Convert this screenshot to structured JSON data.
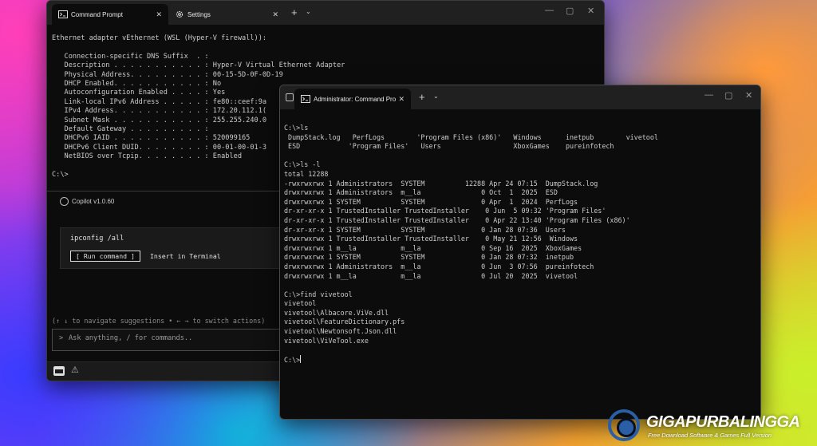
{
  "window1": {
    "tabs": [
      {
        "label": "Command Prompt",
        "icon": "terminal-icon",
        "active": true
      },
      {
        "label": "Settings",
        "icon": "gear-icon",
        "active": false
      }
    ],
    "new_tab": "+",
    "dropdown": "⌄",
    "controls": {
      "minimize": "—",
      "maximize": "▢",
      "close": "✕"
    },
    "lines": [
      "Ethernet adapter vEthernet (WSL (Hyper-V firewall)):",
      "",
      "   Connection-specific DNS Suffix  . :",
      "   Description . . . . . . . . . . . : Hyper-V Virtual Ethernet Adapter",
      "   Physical Address. . . . . . . . . : 00-15-5D-0F-0D-19",
      "   DHCP Enabled. . . . . . . . . . . : No",
      "   Autoconfiguration Enabled . . . . : Yes",
      "   Link-local IPv6 Address . . . . . : fe80::ceef:9a",
      "   IPv4 Address. . . . . . . . . . . : 172.20.112.1(",
      "   Subnet Mask . . . . . . . . . . . : 255.255.240.0",
      "   Default Gateway . . . . . . . . . :",
      "   DHCPv6 IAID . . . . . . . . . . . : 520099165",
      "   DHCPv6 Client DUID. . . . . . . . : 00-01-00-01-3",
      "   NetBIOS over Tcpip. . . . . . . . : Enabled",
      "",
      "C:\\>"
    ]
  },
  "copilot": {
    "title": "Copilot v1.0.60",
    "command": "ipconfig /all",
    "run_label": "[ Run command ]",
    "insert_label": "Insert in Terminal",
    "hint": "(↑ ↓ to navigate suggestions • ← → to switch actions)",
    "prompt_symbol": ">",
    "input_placeholder": "Ask anything, / for commands.."
  },
  "window2": {
    "tab": {
      "label": "Administrator: Command Pro",
      "icon": "terminal-icon"
    },
    "new_tab": "+",
    "dropdown": "⌄",
    "controls": {
      "minimize": "—",
      "maximize": "▢",
      "close": "✕"
    },
    "lines": [
      "C:\\>ls",
      " DumpStack.log   PerfLogs        'Program Files (x86)'   Windows      inetpub        vivetool",
      " ESD            'Program Files'   Users                  XboxGames    pureinfotech",
      "",
      "C:\\>ls -l",
      "total 12288",
      "-rwxrwxrwx 1 Administrators  SYSTEM          12288 Apr 24 07:15  DumpStack.log",
      "drwxrwxrwx 1 Administrators  m__la               0 Oct  1  2025  ESD",
      "drwxrwxrwx 1 SYSTEM          SYSTEM              0 Apr  1  2024  PerfLogs",
      "dr-xr-xr-x 1 TrustedInstaller TrustedInstaller    0 Jun  5 09:32 'Program Files'",
      "dr-xr-xr-x 1 TrustedInstaller TrustedInstaller    0 Apr 22 13:40 'Program Files (x86)'",
      "dr-xr-xr-x 1 SYSTEM          SYSTEM              0 Jan 28 07:36  Users",
      "drwxrwxrwx 1 TrustedInstaller TrustedInstaller    0 May 21 12:56  Windows",
      "drwxrwxrwx 1 m__la           m__la               0 Sep 16  2025  XboxGames",
      "drwxrwxrwx 1 SYSTEM          SYSTEM              0 Jan 28 07:32  inetpub",
      "drwxrwxrwx 1 Administrators  m__la               0 Jun  3 07:56  pureinfotech",
      "drwxrwxrwx 1 m__la           m__la               0 Jul 20  2025  vivetool",
      "",
      "C:\\>find vivetool",
      "vivetool",
      "vivetool\\Albacore.ViVe.dll",
      "vivetool\\FeatureDictionary.pfs",
      "vivetool\\Newtonsoft.Json.dll",
      "vivetool\\ViVeTool.exe",
      "",
      "C:\\>"
    ]
  },
  "logo": {
    "title": "GIGAPURBALINGGA",
    "subtitle": "Free Download Software & Games Full Version"
  },
  "colors": {
    "terminal_bg": "#0c0c0c",
    "terminal_text": "#cccccc",
    "tabbar_bg": "#202020",
    "logo_blue": "#2a5fa8"
  }
}
